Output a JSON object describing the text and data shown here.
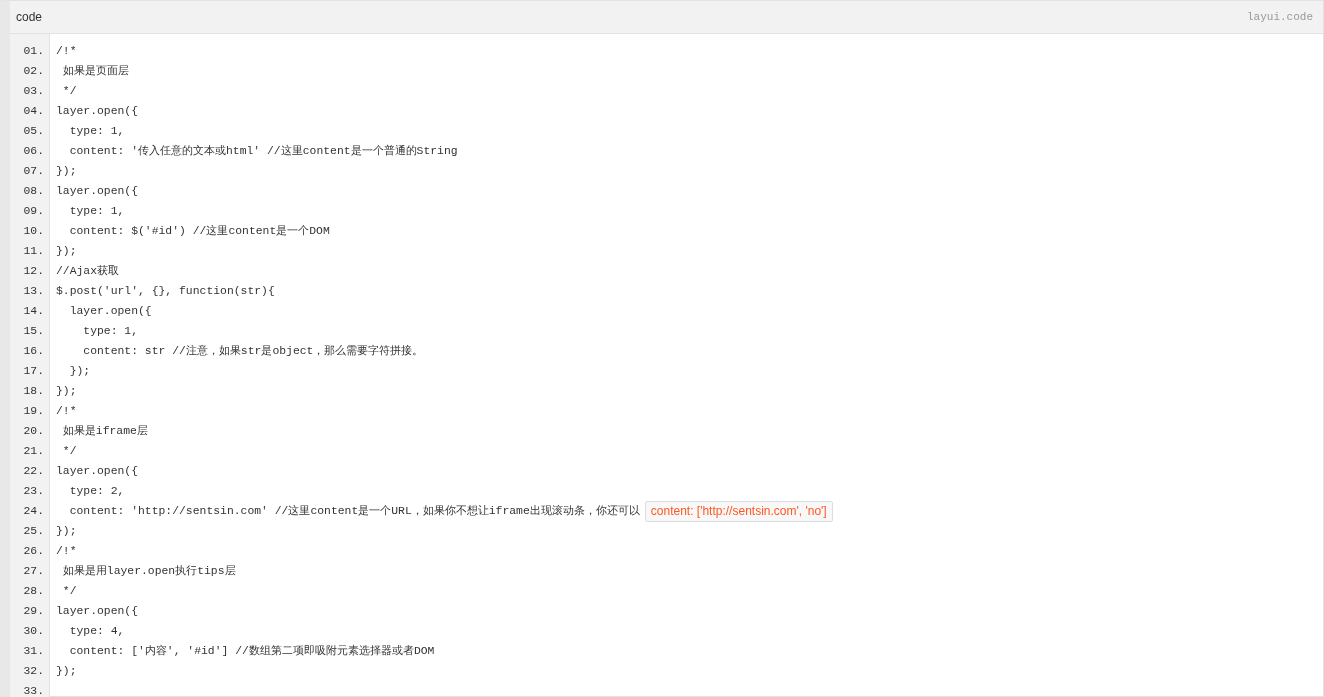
{
  "header": {
    "title": "code",
    "brand": "layui.code"
  },
  "lines": [
    {
      "number": "01.",
      "text": "/!*"
    },
    {
      "number": "02.",
      "text": " 如果是页面层"
    },
    {
      "number": "03.",
      "text": " */"
    },
    {
      "number": "04.",
      "text": "layer.open({"
    },
    {
      "number": "05.",
      "text": "  type: 1,"
    },
    {
      "number": "06.",
      "text": "  content: '传入任意的文本或html' //这里content是一个普通的String"
    },
    {
      "number": "07.",
      "text": "});"
    },
    {
      "number": "08.",
      "text": "layer.open({"
    },
    {
      "number": "09.",
      "text": "  type: 1,"
    },
    {
      "number": "10.",
      "text": "  content: $('#id') //这里content是一个DOM"
    },
    {
      "number": "11.",
      "text": "});"
    },
    {
      "number": "12.",
      "text": "//Ajax获取"
    },
    {
      "number": "13.",
      "text": "$.post('url', {}, function(str){"
    },
    {
      "number": "14.",
      "text": "  layer.open({"
    },
    {
      "number": "15.",
      "text": "    type: 1,"
    },
    {
      "number": "16.",
      "text": "    content: str //注意，如果str是object，那么需要字符拼接。"
    },
    {
      "number": "17.",
      "text": "  });"
    },
    {
      "number": "18.",
      "text": "});"
    },
    {
      "number": "19.",
      "text": "/!*"
    },
    {
      "number": "20.",
      "text": " 如果是iframe层"
    },
    {
      "number": "21.",
      "text": " */"
    },
    {
      "number": "22.",
      "text": "layer.open({"
    },
    {
      "number": "23.",
      "text": "  type: 2,"
    },
    {
      "number": "24.",
      "text": "  content: 'http://sentsin.com' //这里content是一个URL，如果你不想让iframe出现滚动条，你还可以",
      "inline_code": "content: ['http://sentsin.com', 'no']"
    },
    {
      "number": "25.",
      "text": "});"
    },
    {
      "number": "26.",
      "text": "/!*"
    },
    {
      "number": "27.",
      "text": " 如果是用layer.open执行tips层"
    },
    {
      "number": "28.",
      "text": " */"
    },
    {
      "number": "29.",
      "text": "layer.open({"
    },
    {
      "number": "30.",
      "text": "  type: 4,"
    },
    {
      "number": "31.",
      "text": "  content: ['内容', '#id'] //数组第二项即吸附元素选择器或者DOM"
    },
    {
      "number": "32.",
      "text": "});"
    },
    {
      "number": "33."
    }
  ]
}
